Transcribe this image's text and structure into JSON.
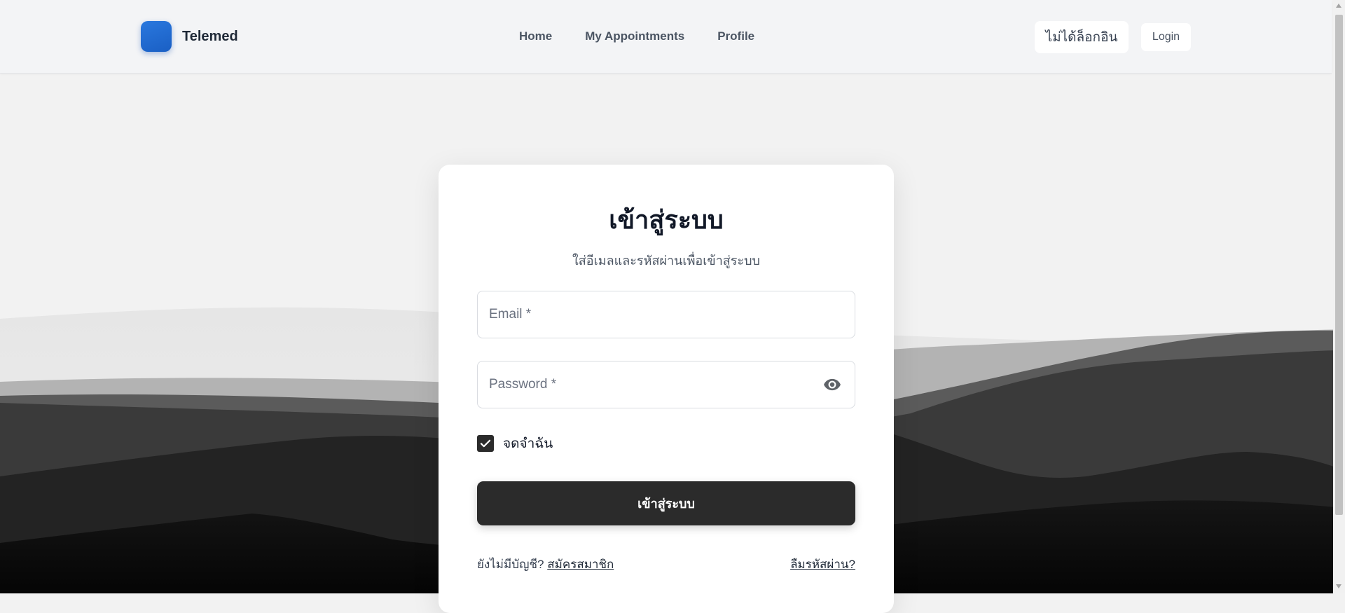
{
  "header": {
    "brand_name": "Telemed",
    "nav": [
      "Home",
      "My Appointments",
      "Profile"
    ],
    "status_text": "ไม่ได้ล็อกอิน",
    "login_label": "Login"
  },
  "login_card": {
    "title": "เข้าสู่ระบบ",
    "subtitle": "ใส่อีเมลและรหัสผ่านเพื่อเข้าสู่ระบบ",
    "email_placeholder": "Email *",
    "email_value": "",
    "password_placeholder": "Password *",
    "password_value": "",
    "remember_label": "จดจำฉัน",
    "remember_checked": true,
    "submit_label": "เข้าสู่ระบบ",
    "no_account_text": "ยังไม่มีบัญชี?",
    "signup_link": "สมัครสมาชิก",
    "forgot_link": "ลืมรหัสผ่าน?"
  },
  "colors": {
    "brand_blue": "#1f6fd6",
    "primary_button": "#2b2b2b",
    "header_bg": "#f3f4f6",
    "page_bg": "#f2f2f2"
  },
  "icons": {
    "password_toggle": "eye-icon",
    "checkbox": "checkmark-icon"
  }
}
